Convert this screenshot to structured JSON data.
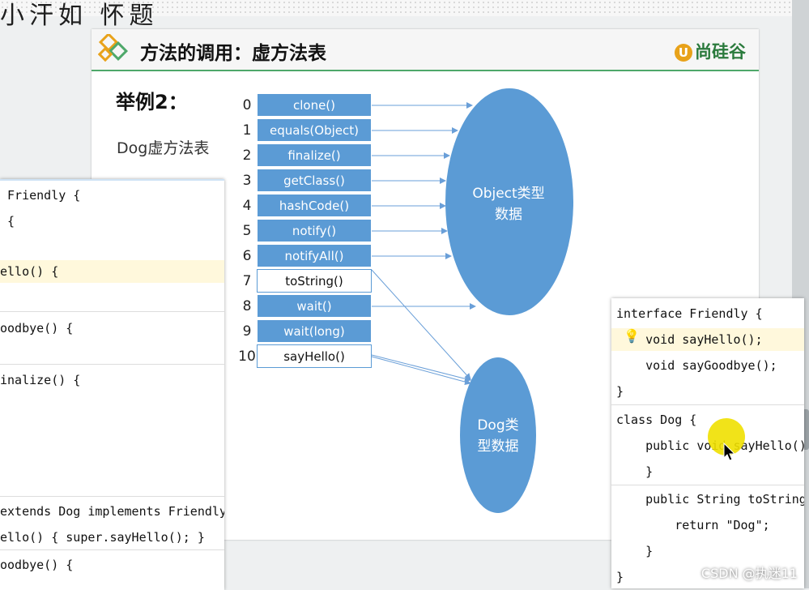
{
  "top_title": "小汗如 怀题",
  "slide": {
    "title": "方法的调用：虚方法表",
    "brand": "尚硅谷",
    "brand_mark": "U",
    "example_label": "举例2：",
    "subtitle": "Dog虚方法表",
    "table": [
      {
        "index": "0",
        "method": "clone()",
        "style": "blue"
      },
      {
        "index": "1",
        "method": "equals(Object)",
        "style": "blue"
      },
      {
        "index": "2",
        "method": "finalize()",
        "style": "blue"
      },
      {
        "index": "3",
        "method": "getClass()",
        "style": "blue"
      },
      {
        "index": "4",
        "method": "hashCode()",
        "style": "blue"
      },
      {
        "index": "5",
        "method": "notify()",
        "style": "blue"
      },
      {
        "index": "6",
        "method": "notifyAll()",
        "style": "blue"
      },
      {
        "index": "7",
        "method": "toString()",
        "style": "white"
      },
      {
        "index": "8",
        "method": "wait()",
        "style": "blue"
      },
      {
        "index": "9",
        "method": "wait(long)",
        "style": "blue"
      },
      {
        "index": "10",
        "method": "sayHello()",
        "style": "white"
      }
    ],
    "object_ellipse": [
      "Object类型",
      "数据"
    ],
    "dog_ellipse": [
      "Dog类",
      "型数据"
    ],
    "colors": {
      "cell_blue": "#5b9bd5",
      "ellipse": "#5b9bd5",
      "header_accent": "#4ea86a"
    }
  },
  "left_editor": {
    "lines": [
      " Friendly {",
      " {",
      "",
      "ello() {",
      "",
      "oodbye() {",
      "",
      "inalize() {",
      "extends Dog implements Friendly {",
      "ello() { super.sayHello(); }",
      "oodbye() {"
    ]
  },
  "right_editor": {
    "lines": [
      "interface Friendly {",
      "    void sayHello();",
      "    void sayGoodbye();",
      "}",
      "class Dog {",
      "    public void sayHello()",
      "    }",
      "    public String toString(",
      "        return \"Dog\";",
      "    }",
      "}"
    ]
  },
  "watermark": "CSDN @执迷11"
}
